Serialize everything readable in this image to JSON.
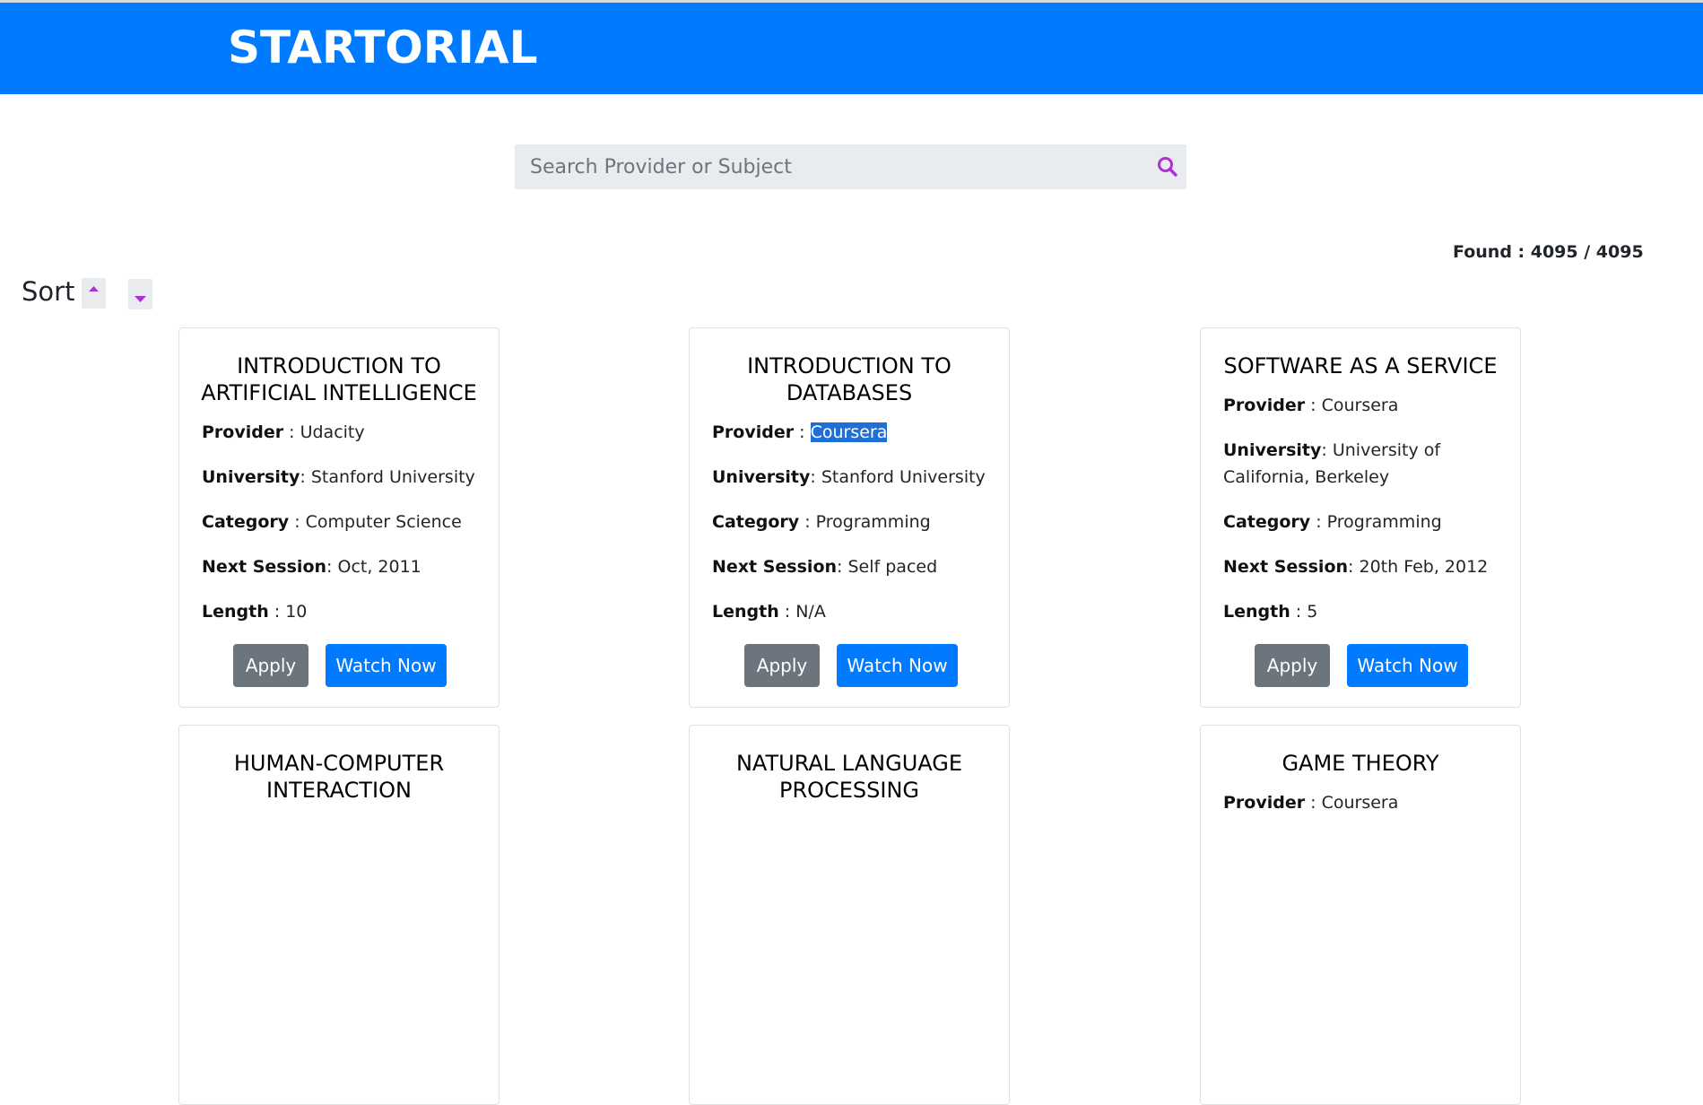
{
  "header": {
    "brand": "STARTORIAL"
  },
  "search": {
    "placeholder": "Search Provider or Subject",
    "value": ""
  },
  "results": {
    "found_text": "Found : 4095 / 4095"
  },
  "sort": {
    "label": "Sort"
  },
  "labels": {
    "provider": "Provider",
    "university": "University",
    "category": "Category",
    "next_session": "Next Session",
    "length": "Length",
    "apply": "Apply",
    "watch": "Watch Now"
  },
  "courses": [
    {
      "title": "INTRODUCTION TO ARTIFICIAL INTELLIGENCE",
      "provider": "Udacity",
      "university": "Stanford University",
      "category": "Computer Science",
      "next_session": "Oct, 2011",
      "length": "10"
    },
    {
      "title": "INTRODUCTION TO DATABASES",
      "provider": "Coursera",
      "university": "Stanford University",
      "category": "Programming",
      "next_session": "Self paced",
      "length": "N/A"
    },
    {
      "title": "SOFTWARE AS A SERVICE",
      "provider": "Coursera",
      "university": "University of California, Berkeley",
      "category": "Programming",
      "next_session": "20th Feb, 2012",
      "length": "5"
    },
    {
      "title": "HUMAN-COMPUTER INTERACTION"
    },
    {
      "title": "NATURAL LANGUAGE PROCESSING"
    },
    {
      "title": "GAME THEORY",
      "provider": "Coursera"
    }
  ],
  "colors": {
    "primary": "#007bff",
    "secondary": "#6c757d",
    "icon_accent": "#b12ed6"
  }
}
